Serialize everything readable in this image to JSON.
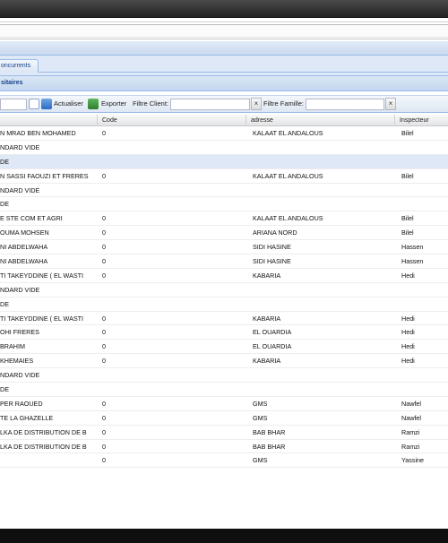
{
  "tabs": [
    {
      "label": "oncurrents"
    }
  ],
  "panel": {
    "title": "sitaires"
  },
  "toolbar": {
    "search_value": "",
    "refresh_label": "Actualiser",
    "export_label": "Exporter",
    "client_filter_label": "Filtre Client:",
    "client_filter_value": "",
    "family_filter_label": "Filtre Famille:",
    "family_filter_value": "",
    "clear_glyph": "×"
  },
  "grid": {
    "columns": [
      "Code",
      "adresse",
      "Inspecteur"
    ],
    "rows": [
      {
        "name": "N MRAD BEN MOHAMED",
        "code": "0",
        "address": "KALAAT EL ANDALOUS",
        "inspector": "Bilel"
      },
      {
        "name": "NDARD VIDE",
        "code": "",
        "address": "",
        "inspector": ""
      },
      {
        "name": "DE",
        "code": "",
        "address": "",
        "inspector": "",
        "group": true
      },
      {
        "name": "N SASSI FAOUZI ET FRERES",
        "code": "0",
        "address": "KALAAT EL ANDALOUS",
        "inspector": "Bilel"
      },
      {
        "name": "NDARD VIDE",
        "code": "",
        "address": "",
        "inspector": ""
      },
      {
        "name": "DE",
        "code": "",
        "address": "",
        "inspector": ""
      },
      {
        "name": "E STE COM ET AGRI",
        "code": "0",
        "address": "KALAAT EL ANDALOUS",
        "inspector": "Bilel"
      },
      {
        "name": "OUMA MOHSEN",
        "code": "0",
        "address": "ARIANA NORD",
        "inspector": "Bilel"
      },
      {
        "name": "NI ABDELWAHA",
        "code": "0",
        "address": "SIDI HASINE",
        "inspector": "Hassen"
      },
      {
        "name": "NI ABDELWAHA",
        "code": "0",
        "address": "SIDI HASINE",
        "inspector": "Hassen"
      },
      {
        "name": "TI TAKEYDDINE ( EL WASTI",
        "code": "0",
        "address": "KABARIA",
        "inspector": "Hedi"
      },
      {
        "name": "NDARD VIDE",
        "code": "",
        "address": "",
        "inspector": ""
      },
      {
        "name": "DE",
        "code": "",
        "address": "",
        "inspector": ""
      },
      {
        "name": "TI TAKEYDDINE ( EL WASTI",
        "code": "0",
        "address": "KABARIA",
        "inspector": "Hedi"
      },
      {
        "name": "OHI FRERES",
        "code": "0",
        "address": "EL OUARDIA",
        "inspector": "Hedi"
      },
      {
        "name": "BRAHIM",
        "code": "0",
        "address": "EL OUARDIA",
        "inspector": "Hedi"
      },
      {
        "name": "KHEMAIES",
        "code": "0",
        "address": "KABARIA",
        "inspector": "Hedi"
      },
      {
        "name": "NDARD VIDE",
        "code": "",
        "address": "",
        "inspector": ""
      },
      {
        "name": "DE",
        "code": "",
        "address": "",
        "inspector": ""
      },
      {
        "name": "PER RAOUED",
        "code": "0",
        "address": "GMS",
        "inspector": "Nawfel"
      },
      {
        "name": "TE LA GHAZELLE",
        "code": "0",
        "address": "GMS",
        "inspector": "Nawfel"
      },
      {
        "name": "LKA DE DISTRIBUTION DE B",
        "code": "0",
        "address": "BAB BHAR",
        "inspector": "Ramzi"
      },
      {
        "name": "LKA DE DISTRIBUTION DE B",
        "code": "0",
        "address": "BAB BHAR",
        "inspector": "Ramzi"
      },
      {
        "name": "",
        "code": "0",
        "address": "GMS",
        "inspector": "Yassine"
      }
    ]
  },
  "colors": {
    "accent": "#15428b",
    "border": "#99bbe8",
    "group_row": "#dfe8f6"
  }
}
